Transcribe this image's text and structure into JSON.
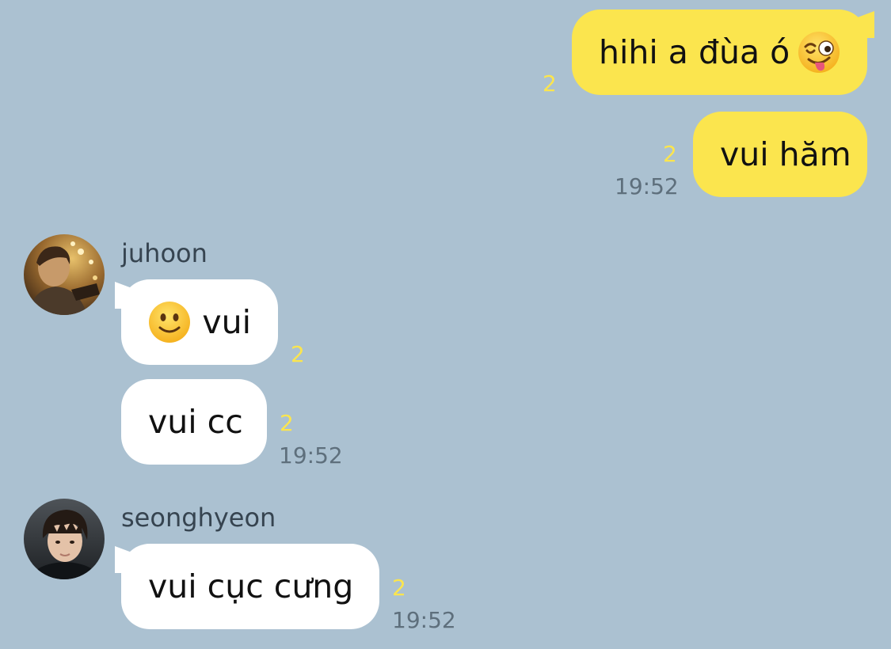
{
  "chat": {
    "messages": [
      {
        "sender": "me",
        "text": "hihi a đùa ó",
        "emoji": "winking-face-with-tongue-icon",
        "unread": "2",
        "time": ""
      },
      {
        "sender": "me",
        "text": "vui hăm",
        "unread": "2",
        "time": "19:52"
      },
      {
        "sender": "juhoon",
        "text": "vui",
        "emoji": "slightly-smiling-face-icon",
        "unread": "2",
        "time": ""
      },
      {
        "sender": "juhoon",
        "text": "vui cc",
        "unread": "2",
        "time": "19:52"
      },
      {
        "sender": "seonghyeon",
        "text": "vui cục cưng",
        "unread": "2",
        "time": "19:52"
      }
    ],
    "senders": {
      "juhoon": {
        "name": "juhoon",
        "avatar": "user-avatar-photo"
      },
      "seonghyeon": {
        "name": "seonghyeon",
        "avatar": "user-avatar-photo"
      }
    }
  },
  "colors": {
    "background": "#abc1d1",
    "outgoing_bubble": "#fbe54e",
    "incoming_bubble": "#ffffff",
    "unread_count": "#fbe54e",
    "timestamp": "#5e6f7c"
  }
}
